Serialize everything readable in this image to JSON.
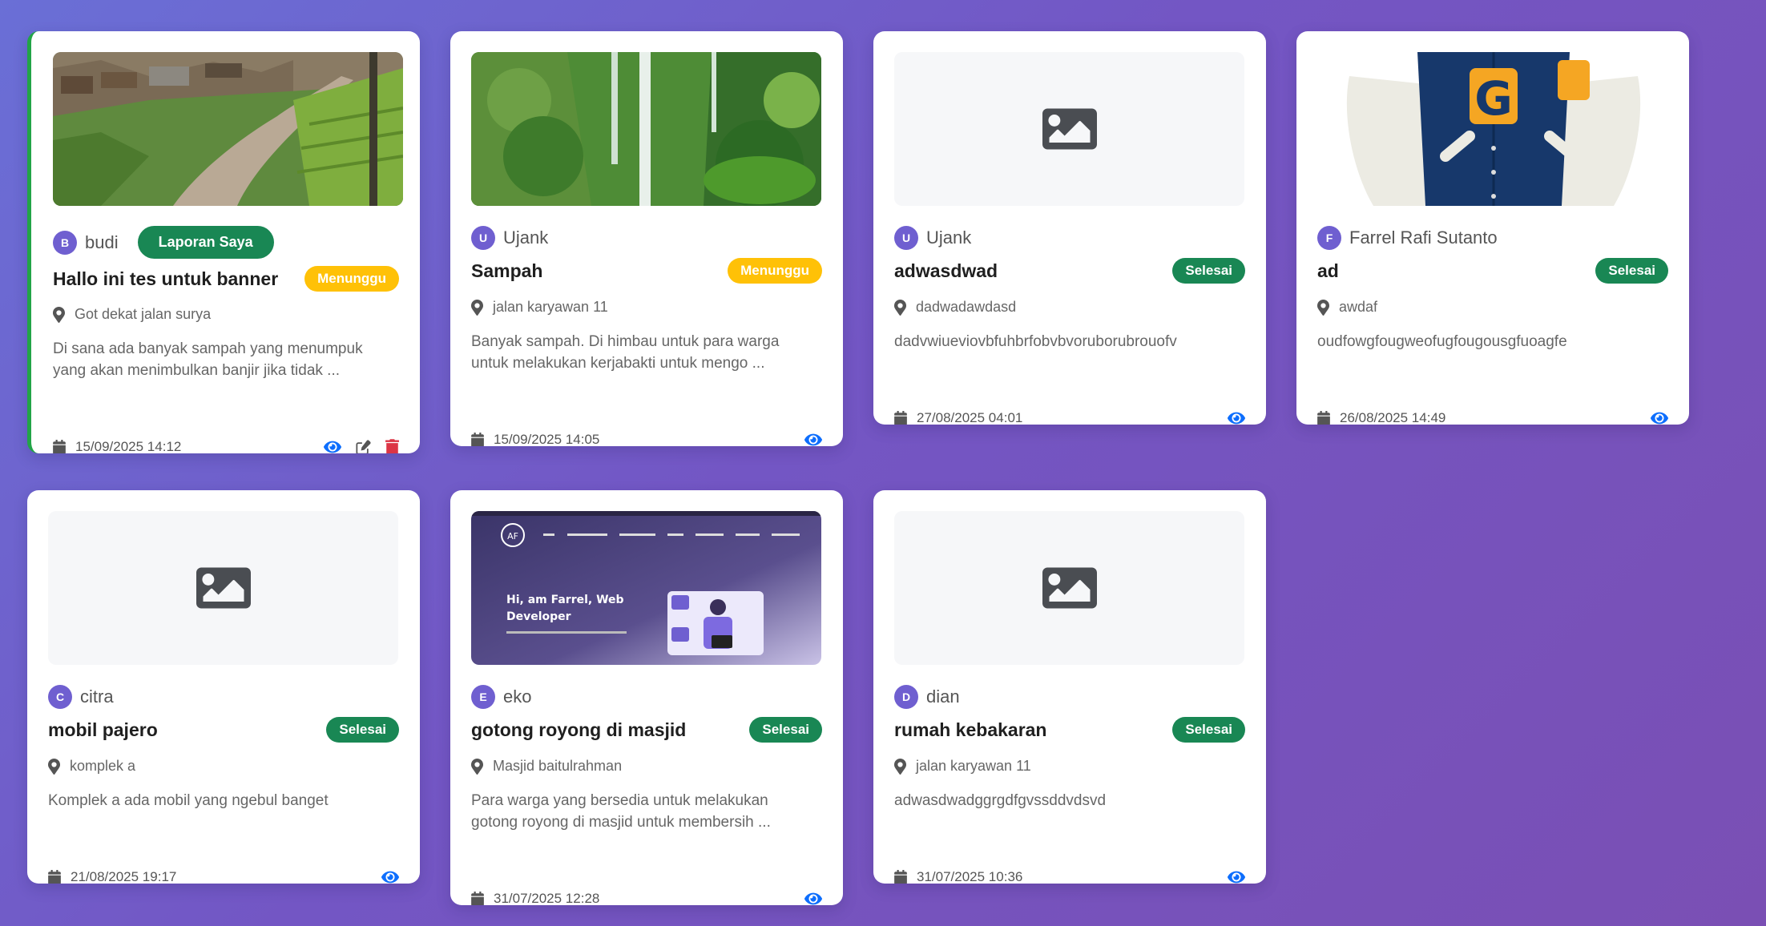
{
  "labels": {
    "my_report_button": "Laporan Saya"
  },
  "colors": {
    "accent_green": "#198754",
    "pending_yellow": "#ffc107",
    "view_blue": "#0d6efd",
    "delete_red": "#dc3545",
    "avatar_purple": "#6f5fd0"
  },
  "cards": [
    {
      "avatar": "B",
      "author": "budi",
      "title": "Hallo ini tes untuk banner",
      "status": "Menunggu",
      "location": "Got dekat jalan surya",
      "desc_1": "Di sana ada banyak sampah yang menumpuk",
      "desc_2": "yang akan menimbulkan banjir jika tidak ...",
      "date": "15/09/2025 14:12",
      "image": "river-village-photo",
      "own": true
    },
    {
      "avatar": "U",
      "author": "Ujank",
      "title": "Sampah",
      "status": "Menunggu",
      "location": "jalan karyawan 11",
      "desc_1": "Banyak sampah. Di himbau untuk para warga",
      "desc_2": "untuk melakukan kerjabakti untuk mengo ...",
      "date": "15/09/2025 14:05",
      "image": "waterfall-photo"
    },
    {
      "avatar": "U",
      "author": "Ujank",
      "title": "adwasdwad",
      "status": "Selesai",
      "location": "dadwadawdasd",
      "desc_1": "dadvwiueviovbfuhbrfobvbvoruborubrouofv",
      "date": "27/08/2025 04:01",
      "image": "image-placeholder-icon"
    },
    {
      "avatar": "F",
      "author": "Farrel Rafi Sutanto",
      "title": "ad",
      "status": "Selesai",
      "location": "awdaf",
      "desc_1": "oudfowgfougweofugfougousgfuoagfe",
      "date": "26/08/2025 14:49",
      "image": "varsity-jacket-photo"
    },
    {
      "avatar": "C",
      "author": "citra",
      "title": "mobil pajero",
      "status": "Selesai",
      "location": "komplek a",
      "desc_1": "Komplek a ada mobil yang ngebul banget",
      "date": "21/08/2025 19:17",
      "image": "image-placeholder-icon"
    },
    {
      "avatar": "E",
      "author": "eko",
      "title": "gotong royong di masjid",
      "status": "Selesai",
      "location": "Masjid baitulrahman",
      "desc_1": "Para warga yang bersedia untuk melakukan",
      "desc_2": "gotong royong di masjid untuk membersih ...",
      "date": "31/07/2025 12:28",
      "image": "website-screenshot",
      "shot_headline": "Hi, am Farrel, Web",
      "shot_headline_2": "Developer",
      "shot_logo": "AF"
    },
    {
      "avatar": "D",
      "author": "dian",
      "title": "rumah kebakaran",
      "status": "Selesai",
      "location": "jalan karyawan 11",
      "desc_1": "adwasdwadggrgdfgvssddvdsvd",
      "date": "31/07/2025 10:36",
      "image": "image-placeholder-icon"
    }
  ]
}
